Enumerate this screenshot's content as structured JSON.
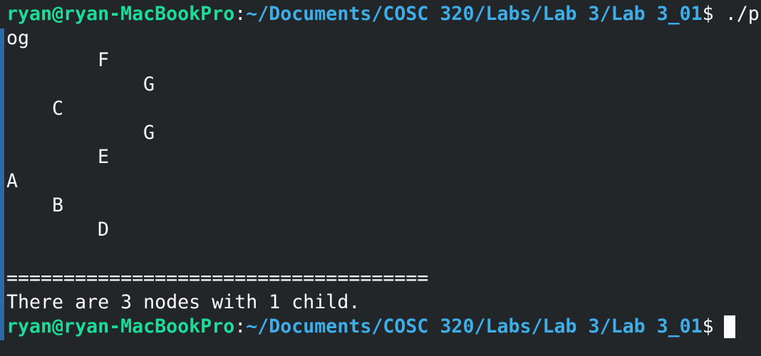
{
  "terminal": {
    "prompt_user": "ryan@ryan-MacBookPro",
    "prompt_sep": ":",
    "prompt_path": "~/Documents/COSC 320/Labs/Lab 3/Lab 3_01",
    "prompt_suffix": "$",
    "command_part1": " ./p",
    "command_part2": "og",
    "tree": [
      "F",
      "G",
      "C",
      "G",
      "E",
      "A",
      "B",
      "D"
    ],
    "separator": "=====================================",
    "result": "There are 3 nodes with 1 child.",
    "colors": {
      "background": "#232629",
      "user": "#1cdc9a",
      "path": "#3daee9",
      "text": "#fcfcfc",
      "scroll_marker": "#2a6aa8"
    }
  }
}
